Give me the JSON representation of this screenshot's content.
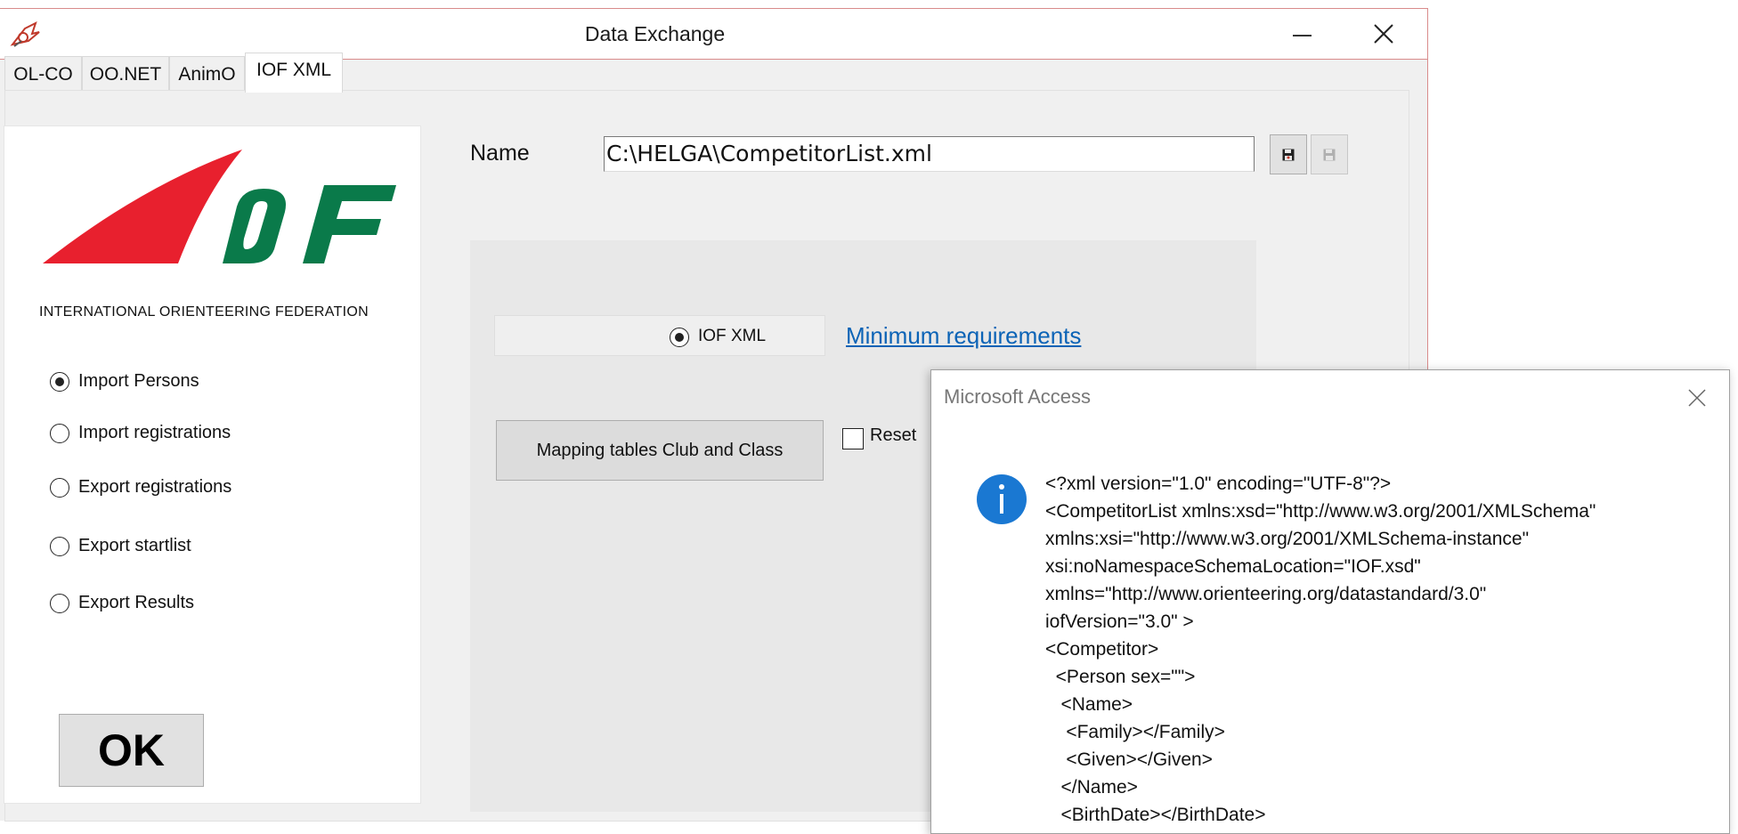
{
  "window": {
    "title": "Data Exchange"
  },
  "tabs": [
    {
      "label": "OL-CO"
    },
    {
      "label": "OO.NET"
    },
    {
      "label": "AnimO"
    },
    {
      "label": "IOF XML",
      "active": true
    }
  ],
  "left_panel": {
    "logo_caption": "INTERNATIONAL ORIENTEERING FEDERATION",
    "options": [
      {
        "label": "Import Persons",
        "checked": true
      },
      {
        "label": "Import registrations",
        "checked": false
      },
      {
        "label": "Export registrations",
        "checked": false
      },
      {
        "label": "Export startlist",
        "checked": false
      },
      {
        "label": "Export Results",
        "checked": false
      }
    ],
    "ok_label": "OK"
  },
  "file": {
    "name_label": "Name",
    "path": "C:\\HELGA\\CompetitorList.xml"
  },
  "format": {
    "option_label": "IOF XML",
    "link_text": "Minimum requirements",
    "mapping_button_label": "Mapping tables Club and Class",
    "reset_label": "Reset",
    "reset_checked": false
  },
  "dialog": {
    "title": "Microsoft Access",
    "message": "<?xml version=\"1.0\" encoding=\"UTF-8\"?>\n<CompetitorList xmlns:xsd=\"http://www.w3.org/2001/XMLSchema\"\nxmlns:xsi=\"http://www.w3.org/2001/XMLSchema-instance\"\nxsi:noNamespaceSchemaLocation=\"IOF.xsd\"\nxmlns=\"http://www.orienteering.org/datastandard/3.0\"\niofVersion=\"3.0\" >\n<Competitor>\n  <Person sex=\"\">\n   <Name>\n    <Family></Family>\n    <Given></Given>\n   </Name>\n   <BirthDate></BirthDate>"
  },
  "colors": {
    "iof_red": "#e8202e",
    "iof_green": "#0a7a4a",
    "link_blue": "#0b63b6",
    "info_blue": "#1a78d2",
    "window_border": "#d98c8c"
  }
}
